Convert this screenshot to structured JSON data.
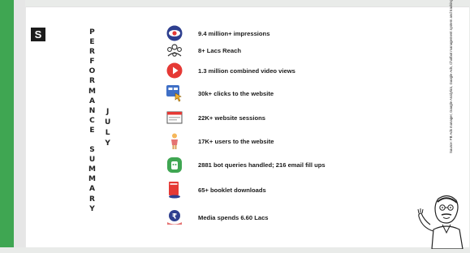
{
  "slide": {
    "logo_letter": "S",
    "title_letters": [
      "P",
      "E",
      "R",
      "F",
      "O",
      "R",
      "M",
      "A",
      "N",
      "C",
      "E",
      "",
      "S",
      "U",
      "M",
      "M",
      "A",
      "R",
      "Y"
    ],
    "month_letters": [
      "J",
      "U",
      "L",
      "Y"
    ]
  },
  "metrics": [
    {
      "icon": "eye-icon",
      "text": "9.4 million+ impressions"
    },
    {
      "icon": "group-reach-icon",
      "text": "8+ Lacs Reach"
    },
    {
      "icon": "play-button-icon",
      "text": "1.3 million combined video views"
    },
    {
      "icon": "click-pointer-icon",
      "text": "30k+ clicks to the website"
    },
    {
      "icon": "browser-window-icon",
      "text": "22K+ website sessions"
    },
    {
      "icon": "user-figure-icon",
      "text": "17K+ users to the website"
    },
    {
      "icon": "chatbot-icon",
      "text": "2881 bot queries handled; 216 email fill ups"
    },
    {
      "icon": "booklet-download-icon",
      "text": "65+ booklet downloads"
    },
    {
      "icon": "media-spend-icon",
      "text": "Media spends 6.60 Lacs"
    }
  ],
  "source_note": "Source: FB Ads manager, Google Analytics, Google Ads, Chatbot management system and tracking codes",
  "colors": {
    "accent_green": "#3fa652",
    "slide_bg": "#ffffff",
    "text": "#1a1a1a"
  }
}
